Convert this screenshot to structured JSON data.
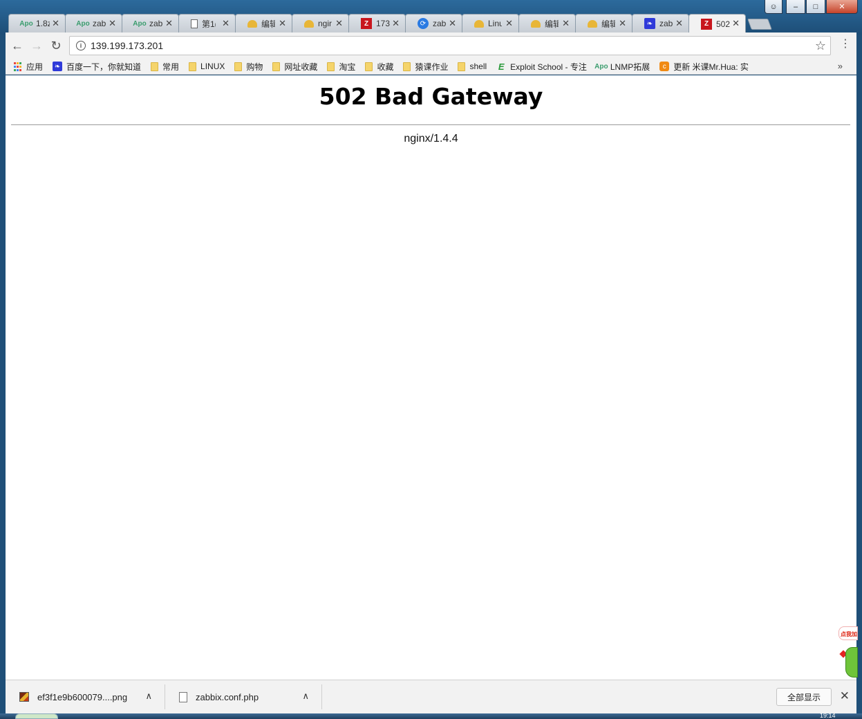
{
  "browser": {
    "tabs": [
      {
        "label": "1.8z",
        "icon": "apo-icon",
        "icon_text": "Apo"
      },
      {
        "label": "zabb",
        "icon": "apo-icon",
        "icon_text": "Apo"
      },
      {
        "label": "zabb",
        "icon": "apo-icon",
        "icon_text": "Apo"
      },
      {
        "label": "第1(",
        "icon": "document-icon",
        "icon_text": ""
      },
      {
        "label": "编辑",
        "icon": "hat-icon",
        "icon_text": ""
      },
      {
        "label": "ngir",
        "icon": "hat-icon",
        "icon_text": ""
      },
      {
        "label": "173",
        "icon": "zabbix-icon",
        "icon_text": "Z"
      },
      {
        "label": "zabb",
        "icon": "circle-icon",
        "icon_text": "⟳"
      },
      {
        "label": "Linu",
        "icon": "hat-icon",
        "icon_text": ""
      },
      {
        "label": "编辑",
        "icon": "hat-icon",
        "icon_text": ""
      },
      {
        "label": "编辑",
        "icon": "hat-icon",
        "icon_text": ""
      },
      {
        "label": "zabb",
        "icon": "baidu-paw-icon",
        "icon_text": "❧"
      },
      {
        "label": "502",
        "icon": "zabbix-icon",
        "icon_text": "Z",
        "active": true
      }
    ],
    "tab_close_glyph": "✕",
    "address": {
      "url": "139.199.173.201",
      "info_glyph": "i",
      "star_glyph": "☆",
      "menu_glyph": "⋮"
    },
    "nav": {
      "back": "←",
      "forward": "→",
      "reload": "↻"
    },
    "bookmarks": [
      {
        "label": "应用",
        "icon": "apps-grid-icon"
      },
      {
        "label": "百度一下，你就知道",
        "icon": "baidu-paw-icon"
      },
      {
        "label": "常用",
        "icon": "folder-icon"
      },
      {
        "label": "LINUX",
        "icon": "folder-icon"
      },
      {
        "label": "购物",
        "icon": "folder-icon"
      },
      {
        "label": "网址收藏",
        "icon": "folder-icon"
      },
      {
        "label": "淘宝",
        "icon": "folder-icon"
      },
      {
        "label": "收藏",
        "icon": "folder-icon"
      },
      {
        "label": "猿课作业",
        "icon": "folder-icon"
      },
      {
        "label": "shell",
        "icon": "folder-icon"
      },
      {
        "label": "Exploit School - 专注",
        "icon": "exploit-icon"
      },
      {
        "label": "LNMP拓展",
        "icon": "apo-icon"
      },
      {
        "label": "更新 米课Mr.Hua: 实",
        "icon": "mike-icon"
      }
    ],
    "bookmarks_more": "»",
    "window_controls": {
      "minimize": "–",
      "maximize": "□",
      "close": "✕"
    }
  },
  "page": {
    "title": "502 Bad Gateway",
    "footer": "nginx/1.4.4",
    "widget_text": "点我加"
  },
  "downloads": {
    "items": [
      {
        "filename": "ef3f1e9b600079....png",
        "icon": "image-file-icon"
      },
      {
        "filename": "zabbix.conf.php",
        "icon": "file-icon"
      }
    ],
    "caret": "∧",
    "show_all": "全部显示",
    "close_glyph": "✕"
  },
  "taskbar": {
    "clock": "19:14"
  }
}
